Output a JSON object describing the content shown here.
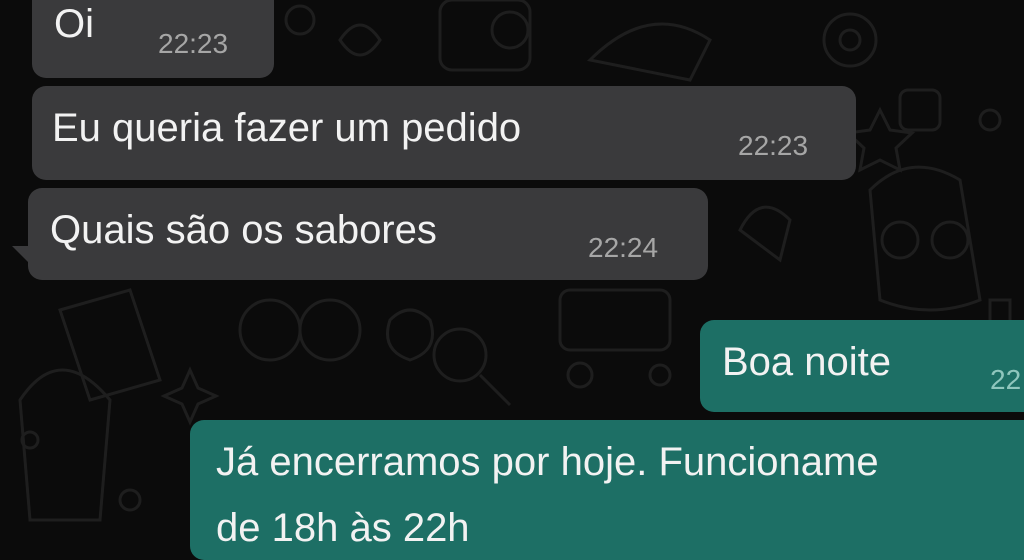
{
  "chat": {
    "messages": [
      {
        "direction": "incoming",
        "text": "Oi",
        "time": "22:23"
      },
      {
        "direction": "incoming",
        "text": "Eu queria fazer um pedido",
        "time": "22:23"
      },
      {
        "direction": "incoming",
        "text": "Quais são os sabores",
        "time": "22:24"
      },
      {
        "direction": "outgoing",
        "text": "Boa noite",
        "time": "22"
      },
      {
        "direction": "outgoing",
        "text": "Já encerramos por hoje. Funcioname",
        "text_line2": "de 18h às 22h"
      }
    ]
  },
  "colors": {
    "background": "#0b0b0b",
    "incoming_bubble": "#3a3a3c",
    "outgoing_bubble": "#1d6f65"
  }
}
